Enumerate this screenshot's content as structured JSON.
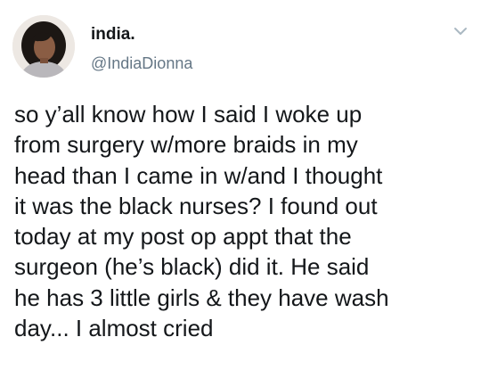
{
  "tweet": {
    "author": {
      "display_name": "india.",
      "handle": "@IndiaDionna",
      "avatar_icon": "profile-photo-avatar"
    },
    "menu_icon": "chevron-down-icon",
    "text_lines": [
      "so y’all know how I said I woke up",
      "from surgery w/more braids in my",
      "head than I came in w/and I thought",
      "it was the black nurses? I found out",
      "today at my post op appt that the",
      "surgeon (he’s black) did it. He said",
      "he has 3 little girls & they have wash",
      "day... I almost cried"
    ]
  },
  "colors": {
    "text": "#14171a",
    "secondary_text": "#657786",
    "chevron": "#aab8c2",
    "background": "#ffffff"
  }
}
